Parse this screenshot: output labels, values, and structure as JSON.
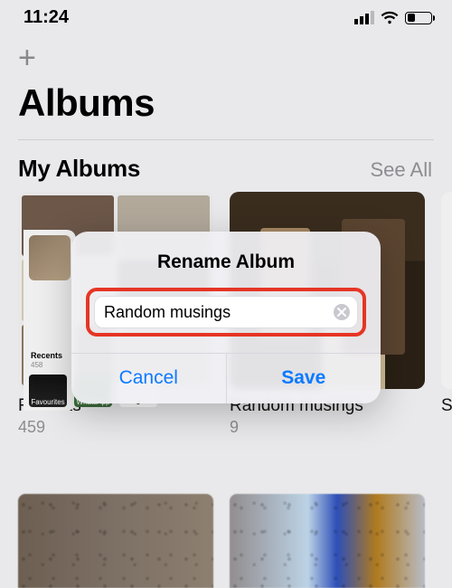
{
  "status": {
    "time": "11:24"
  },
  "header": {
    "page_title": "Albums"
  },
  "section": {
    "title": "My Albums",
    "see_all": "See All"
  },
  "albums": [
    {
      "name": "Recents",
      "count": "459"
    },
    {
      "name": "Random musings",
      "count": "9"
    },
    {
      "name": "S"
    }
  ],
  "ghost": {
    "label": "Recents",
    "sub": "458",
    "chips": [
      "Favourites",
      "WhatsApp",
      "9"
    ]
  },
  "dialog": {
    "title": "Rename Album",
    "value": "Random musings",
    "cancel": "Cancel",
    "save": "Save"
  }
}
